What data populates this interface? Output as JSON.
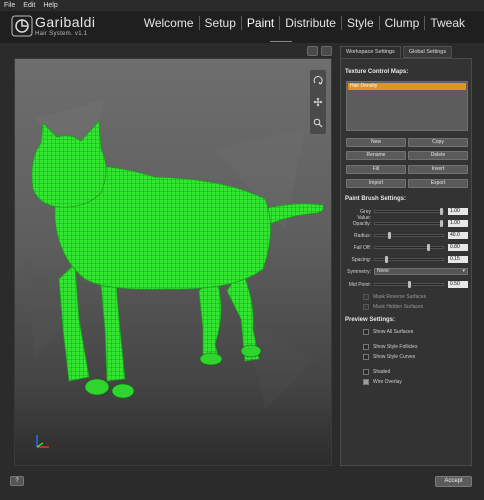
{
  "menu": [
    "File",
    "Edit",
    "Help"
  ],
  "brand": {
    "name": "Garibaldi",
    "subtitle": "Hair System.  v1.1"
  },
  "nav": [
    "Welcome",
    "Setup",
    "Paint",
    "Distribute",
    "Style",
    "Clump",
    "Tweak"
  ],
  "nav_active": "Paint",
  "tabs": [
    "Workspace Settings",
    "Global Settings"
  ],
  "texture": {
    "title": "Texture Control Maps:",
    "selected_map": "Hair Density"
  },
  "buttons": {
    "new": "New",
    "copy": "Copy",
    "rename": "Rename",
    "delete": "Delete",
    "fill": "Fill",
    "invert": "Invert",
    "import": "Import",
    "export": "Export"
  },
  "brush": {
    "title": "Paint Brush Settings:",
    "grey_label": "Grey Value:",
    "grey_value": "1.00",
    "grey_level": 1.0,
    "opacity_label": "Opacity:",
    "opacity_value": "1.00",
    "opacity_level": 1.0,
    "radius_label": "Radius:",
    "radius_value": "40.0",
    "radius_level": 0.2,
    "falloff_label": "Fall Off:",
    "falloff_value": "0.80",
    "falloff_level": 0.8,
    "spacing_label": "Spacing:",
    "spacing_value": "0.15",
    "spacing_level": 0.15,
    "symmetry_label": "Symmetry:",
    "symmetry_value": "None",
    "midpoint_label": "Mid Point:",
    "midpoint_value": "0.50",
    "midpoint_level": 0.5,
    "mask_reverse": "Mask Reverse Surfaces",
    "mask_hidden": "Mask Hidden Surfaces"
  },
  "preview": {
    "title": "Preview Settings:",
    "show_all": "Show All Surfaces",
    "show_follicles": "Show Style Follicles",
    "show_curves": "Show Style Curves",
    "shaded": "Shaded",
    "wire_overlay": "Wire Overlay"
  },
  "bottom": {
    "help": "?",
    "accept": "Accept"
  },
  "colors": {
    "accent": "#e8901c",
    "wire": "#2aff2a"
  },
  "icons": [
    "garibaldi-logo-icon",
    "rotate-icon",
    "pan-icon",
    "zoom-icon",
    "axes-icon"
  ]
}
